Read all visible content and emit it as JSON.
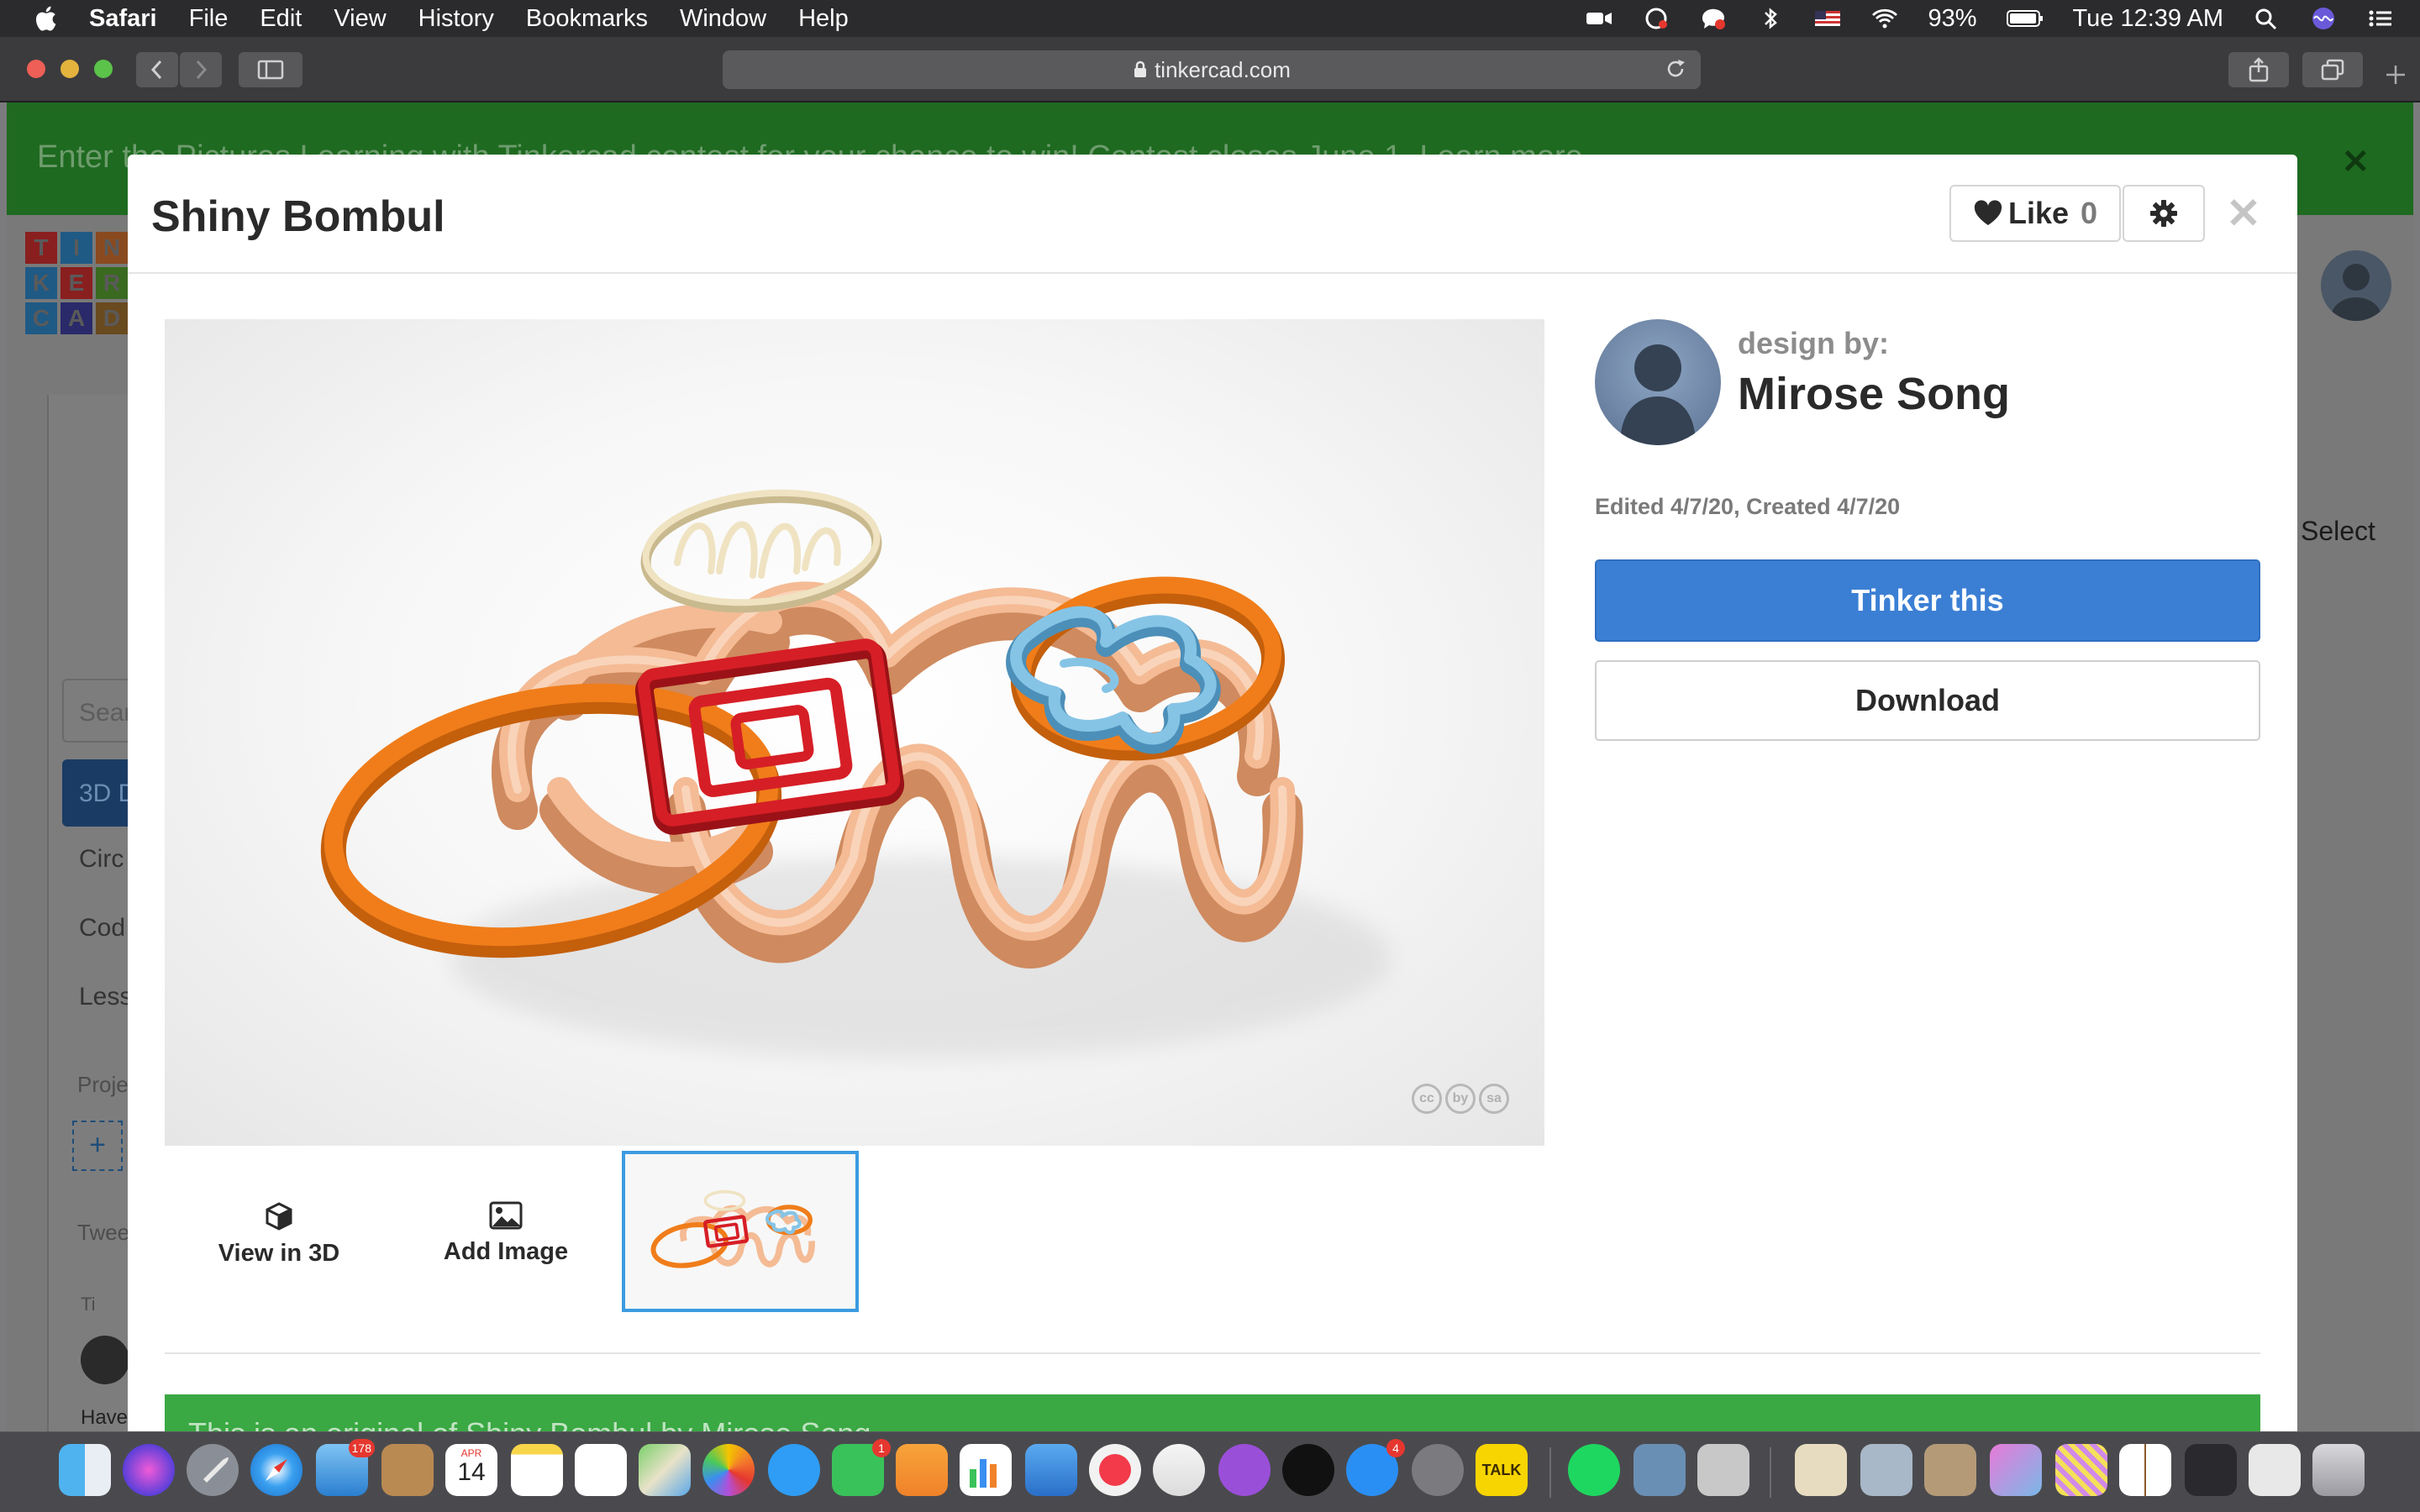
{
  "menubar": {
    "items": [
      "Safari",
      "File",
      "Edit",
      "View",
      "History",
      "Bookmarks",
      "Window",
      "Help"
    ],
    "battery": "93%",
    "clock": "Tue 12:39 AM"
  },
  "browser": {
    "url": "tinkercad.com"
  },
  "background_page": {
    "banner_text": "Enter the Pictures Learning with Tinkercad contest for your chance to win! Contest closes June 1. Learn more",
    "logo_letters": [
      "T",
      "I",
      "N",
      "K",
      "E",
      "R",
      "C",
      "A",
      "D"
    ],
    "logo_colors": [
      "#8a1f1f",
      "#1f5a85",
      "#8a4a1f",
      "#1f5a85",
      "#8a1f1f",
      "#3a6a1f",
      "#1f5a85",
      "#2a2a6a",
      "#6a4a1f"
    ],
    "search_placeholder": "Sear",
    "active_item": "3D D",
    "side_items": [
      "Circ",
      "Cod",
      "Less"
    ],
    "projects_label": "Proje",
    "tweets_label": "Twee",
    "tweet_handle": "Ti",
    "have_label": "Have",
    "select_label": "Select"
  },
  "modal": {
    "title": "Shiny Bombul",
    "like_label": "Like",
    "like_count": "0",
    "designer_label": "design by:",
    "designer_name": "Mirose Song",
    "dates": "Edited 4/7/20, Created 4/7/20",
    "tinker_label": "Tinker this",
    "download_label": "Download",
    "view3d_label": "View in 3D",
    "add_image_label": "Add Image",
    "license_badge": [
      "cc",
      "by",
      "sa"
    ],
    "footer_text": "This is an original of Shiny Bombul by Mirose Song"
  },
  "colors": {
    "accent_blue": "#3b7fd4",
    "banner_green": "#3aa843",
    "model_peach": "#f2b690",
    "model_orange": "#f07d1a",
    "model_red": "#d61e26",
    "model_blue": "#74b8e0",
    "model_cream": "#efe3c2"
  },
  "dock": {
    "apps": [
      "finder-icon",
      "siri-icon",
      "launchpad-icon",
      "safari-icon",
      "mail-icon",
      "contacts-icon",
      "calendar-icon",
      "notes-icon",
      "reminders-icon",
      "maps-icon",
      "photos-icon",
      "messages-icon",
      "facetime-icon",
      "pages-icon",
      "numbers-icon",
      "keynote-icon",
      "news-icon",
      "music-icon",
      "podcasts-icon",
      "tv-icon",
      "app-store-icon",
      "system-preferences-icon",
      "kakaotalk-icon",
      "spotify-icon",
      "preview-icon",
      "image-capture-icon"
    ],
    "badges": {
      "mail": "178",
      "facetime": "1",
      "app_store": "4"
    },
    "calendar_day": "14",
    "calendar_month": "APR",
    "kakao_label": "TALK"
  }
}
